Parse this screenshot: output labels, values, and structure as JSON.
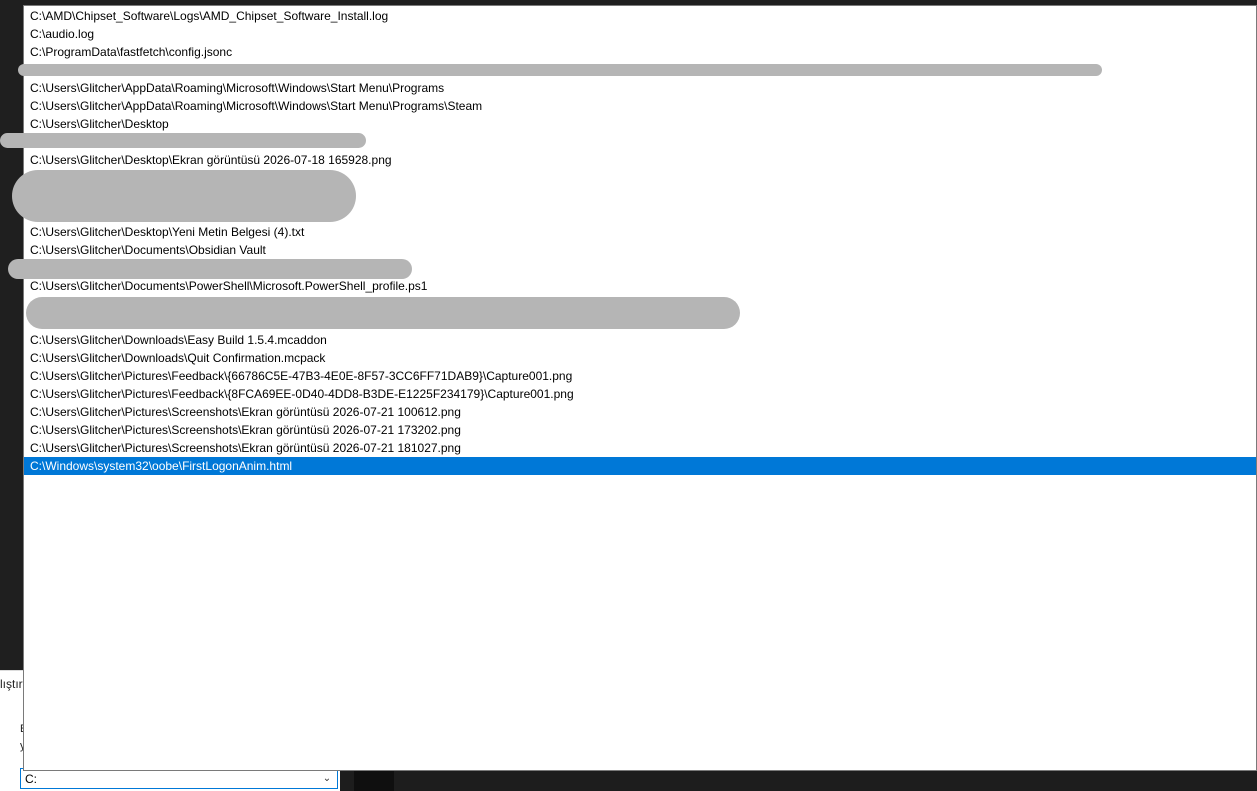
{
  "run_dialog": {
    "title_fragment": "lıştır",
    "text_fragment_1": "E",
    "text_fragment_2": "y",
    "input_value": "C:"
  },
  "autocomplete": {
    "items": [
      {
        "text": "C:\\AMD\\Chipset_Software\\Logs\\AMD_Chipset_Software_Install.log",
        "redacted": false
      },
      {
        "text": "C:\\audio.log",
        "redacted": false
      },
      {
        "text": "C:\\ProgramData\\fastfetch\\config.jsonc",
        "redacted": false
      },
      {
        "text": "",
        "redacted": true
      },
      {
        "text": "C:\\Users\\Glitcher\\AppData\\Roaming\\Microsoft\\Windows\\Start Menu\\Programs",
        "redacted": false
      },
      {
        "text": "C:\\Users\\Glitcher\\AppData\\Roaming\\Microsoft\\Windows\\Start Menu\\Programs\\Steam",
        "redacted": false
      },
      {
        "text": "C:\\Users\\Glitcher\\Desktop",
        "redacted": false
      },
      {
        "text": "",
        "redacted": true
      },
      {
        "text": "C:\\Users\\Glitcher\\Desktop\\Ekran görüntüsü 2026-07-18 165928.png",
        "redacted": false
      },
      {
        "text": "",
        "redacted": true
      },
      {
        "text": "",
        "redacted": true
      },
      {
        "text": "",
        "redacted": true
      },
      {
        "text": "C:\\Users\\Glitcher\\Desktop\\Yeni Metin Belgesi (4).txt",
        "redacted": false
      },
      {
        "text": "C:\\Users\\Glitcher\\Documents\\Obsidian Vault",
        "redacted": false
      },
      {
        "text": "",
        "redacted": true
      },
      {
        "text": "C:\\Users\\Glitcher\\Documents\\PowerShell\\Microsoft.PowerShell_profile.ps1",
        "redacted": false
      },
      {
        "text": "",
        "redacted": true
      },
      {
        "text": "",
        "redacted": true
      },
      {
        "text": "C:\\Users\\Glitcher\\Downloads\\Easy Build 1.5.4.mcaddon",
        "redacted": false
      },
      {
        "text": "C:\\Users\\Glitcher\\Downloads\\Quit Confirmation.mcpack",
        "redacted": false
      },
      {
        "text": "C:\\Users\\Glitcher\\Pictures\\Feedback\\{66786C5E-47B3-4E0E-8F57-3CC6FF71DAB9}\\Capture001.png",
        "redacted": false
      },
      {
        "text": "C:\\Users\\Glitcher\\Pictures\\Feedback\\{8FCA69EE-0D40-4DD8-B3DE-E1225F234179}\\Capture001.png",
        "redacted": false
      },
      {
        "text": "C:\\Users\\Glitcher\\Pictures\\Screenshots\\Ekran görüntüsü 2026-07-21 100612.png",
        "redacted": false
      },
      {
        "text": "C:\\Users\\Glitcher\\Pictures\\Screenshots\\Ekran görüntüsü 2026-07-21 173202.png",
        "redacted": false
      },
      {
        "text": "C:\\Users\\Glitcher\\Pictures\\Screenshots\\Ekran görüntüsü 2026-07-21 181027.png",
        "redacted": false
      },
      {
        "text": "C:\\Windows\\system32\\oobe\\FirstLogonAnim.html",
        "redacted": false,
        "selected": true
      }
    ]
  },
  "colors": {
    "selection": "#0078d7",
    "redaction": "#b5b5b5"
  },
  "icons": {
    "combo_dropdown": "chevron-down-icon"
  }
}
